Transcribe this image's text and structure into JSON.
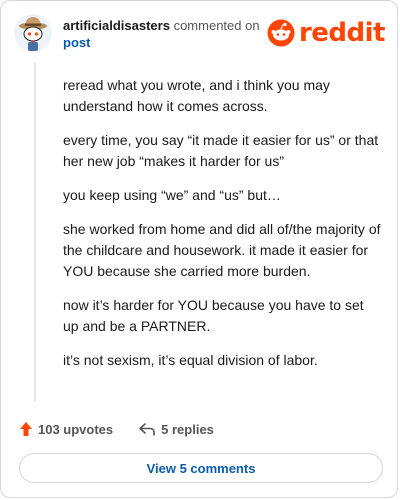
{
  "header": {
    "username": "artificialdisasters",
    "action_text": "commented on",
    "post_link": "post",
    "brand": "reddit"
  },
  "comment": {
    "paragraphs": [
      "reread what you wrote, and i think you may understand how it comes across.",
      "every time, you say “it made it easier for us” or that her new job “makes it harder for us”",
      "you keep using “we” and “us” but…",
      "she worked from home and did all of/the majority of the childcare and housework. it made it easier for YOU because she carried more burden.",
      "now it’s harder for YOU because you have to set up and be a PARTNER.",
      "it’s not sexism, it’s equal division of labor."
    ]
  },
  "actions": {
    "upvotes": "103 upvotes",
    "replies": "5 replies"
  },
  "footer": {
    "view_comments": "View 5 comments"
  },
  "colors": {
    "brand": "#ff4500",
    "link": "#0b5cad"
  },
  "icons": [
    "avatar-icon",
    "reddit-alien-icon",
    "upvote-arrow-icon",
    "reply-arrow-icon"
  ]
}
